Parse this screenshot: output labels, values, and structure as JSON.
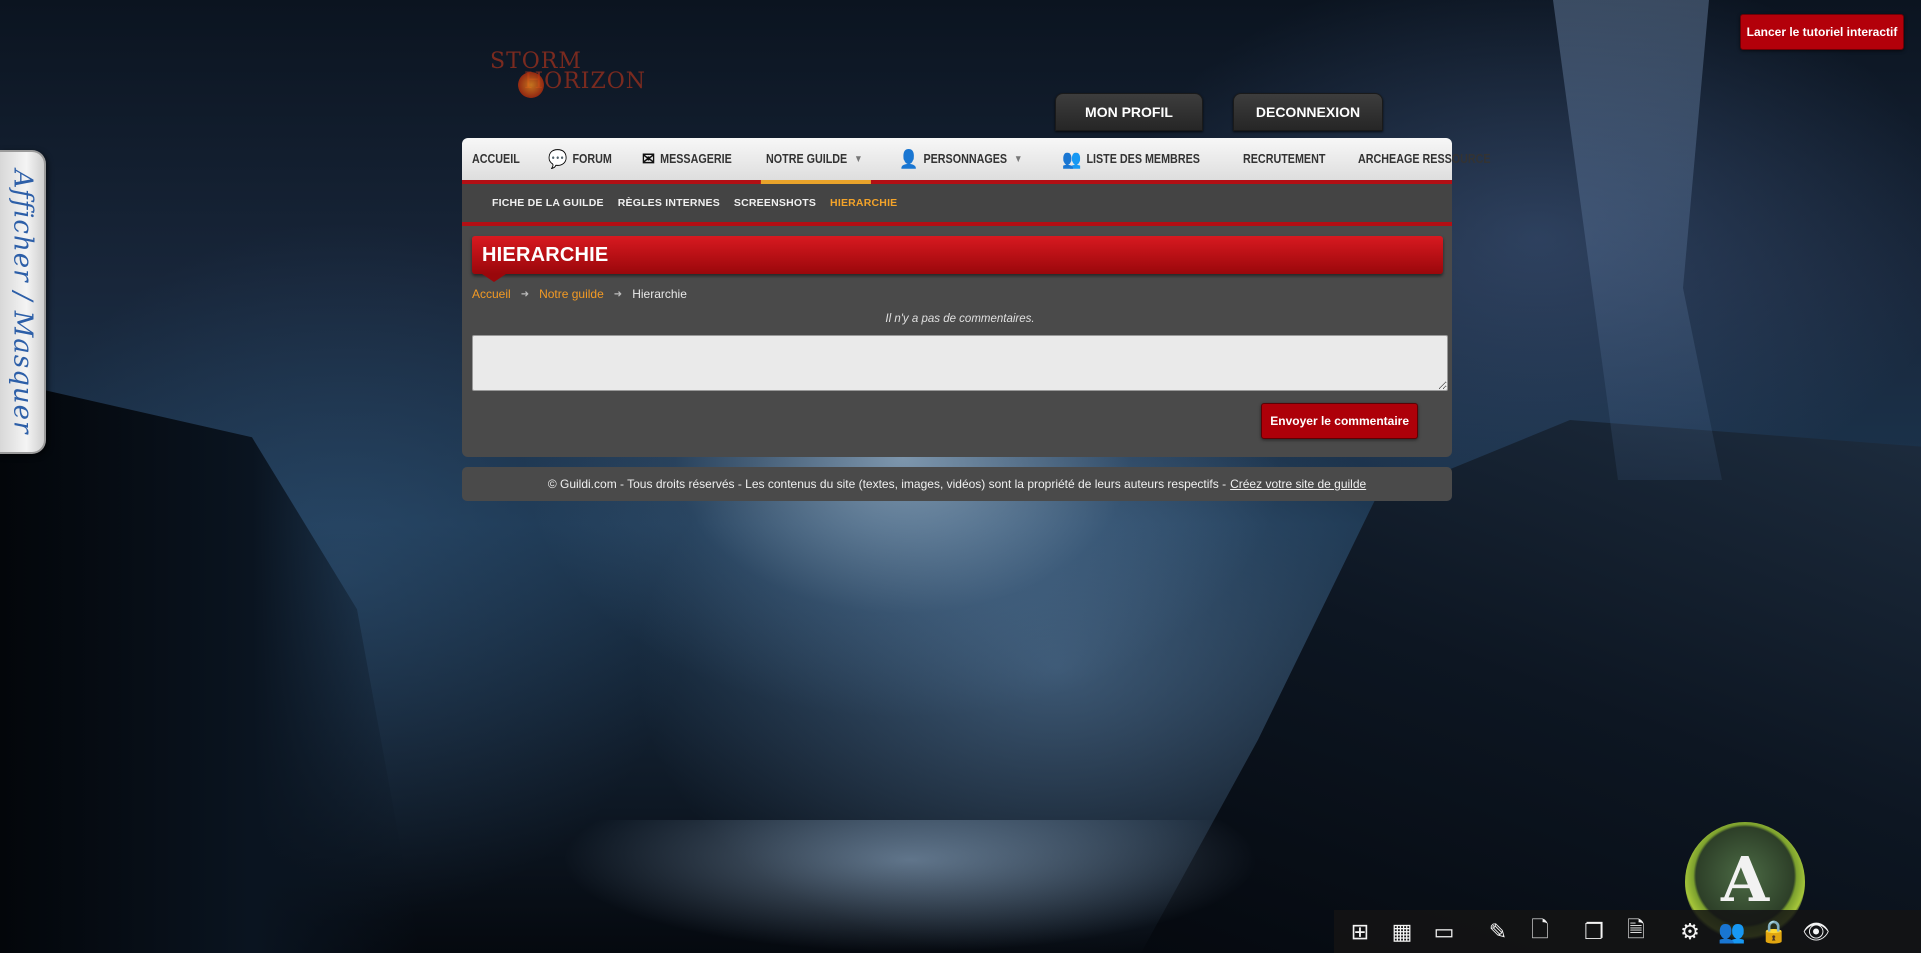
{
  "tutorial_button": "Lancer le tutoriel interactif",
  "side_tab": "Afficher / Masquer",
  "logo": {
    "line1": "STORM",
    "line2": "HORIZON"
  },
  "header_buttons": {
    "profile": "MON PROFIL",
    "logout": "DECONNEXION"
  },
  "nav": {
    "items": [
      {
        "label": "ACCUEIL",
        "icon": ""
      },
      {
        "label": "FORUM",
        "icon": "chat-bubbles-icon"
      },
      {
        "label": "MESSAGERIE",
        "icon": "envelope-icon"
      },
      {
        "label": "NOTRE GUILDE",
        "icon": "",
        "dropdown": true,
        "active": true
      },
      {
        "label": "PERSONNAGES",
        "icon": "user-icon",
        "dropdown": true
      },
      {
        "label": "LISTE DES MEMBRES",
        "icon": "users-icon"
      },
      {
        "label": "RECRUTEMENT",
        "icon": ""
      },
      {
        "label": "ARCHEAGE RESSOURCE",
        "icon": ""
      }
    ]
  },
  "subnav": {
    "items": [
      {
        "label": "FICHE DE LA GUILDE"
      },
      {
        "label": "RÈGLES INTERNES"
      },
      {
        "label": "SCREENSHOTS"
      },
      {
        "label": "HIERARCHIE",
        "active": true
      }
    ]
  },
  "page": {
    "title": "HIERARCHIE",
    "breadcrumb": [
      "Accueil",
      "Notre guilde",
      "Hierarchie"
    ],
    "no_comments": "Il n'y a pas de commentaires.",
    "comment_placeholder": "",
    "submit_label": "Envoyer le commentaire"
  },
  "footer": {
    "text": "© Guildi.com - Tous droits réservés - Les contenus du site (textes, images, vidéos) sont la propriété de leurs auteurs respectifs -",
    "link": "Créez votre site de guilde"
  },
  "arch_logo_letter": "A",
  "toolbar": {
    "icons": [
      "add-block-icon",
      "grid-icon",
      "window-icon",
      "edit-icon",
      "add-page-icon",
      "copy-page-icon",
      "edit-page-icon",
      "settings-icon",
      "members-icon",
      "lock-icon",
      "eye-icon"
    ]
  },
  "colors": {
    "accent_red": "#b20f14",
    "accent_orange": "#f39a24",
    "panel_grey": "#4a4a4a"
  }
}
